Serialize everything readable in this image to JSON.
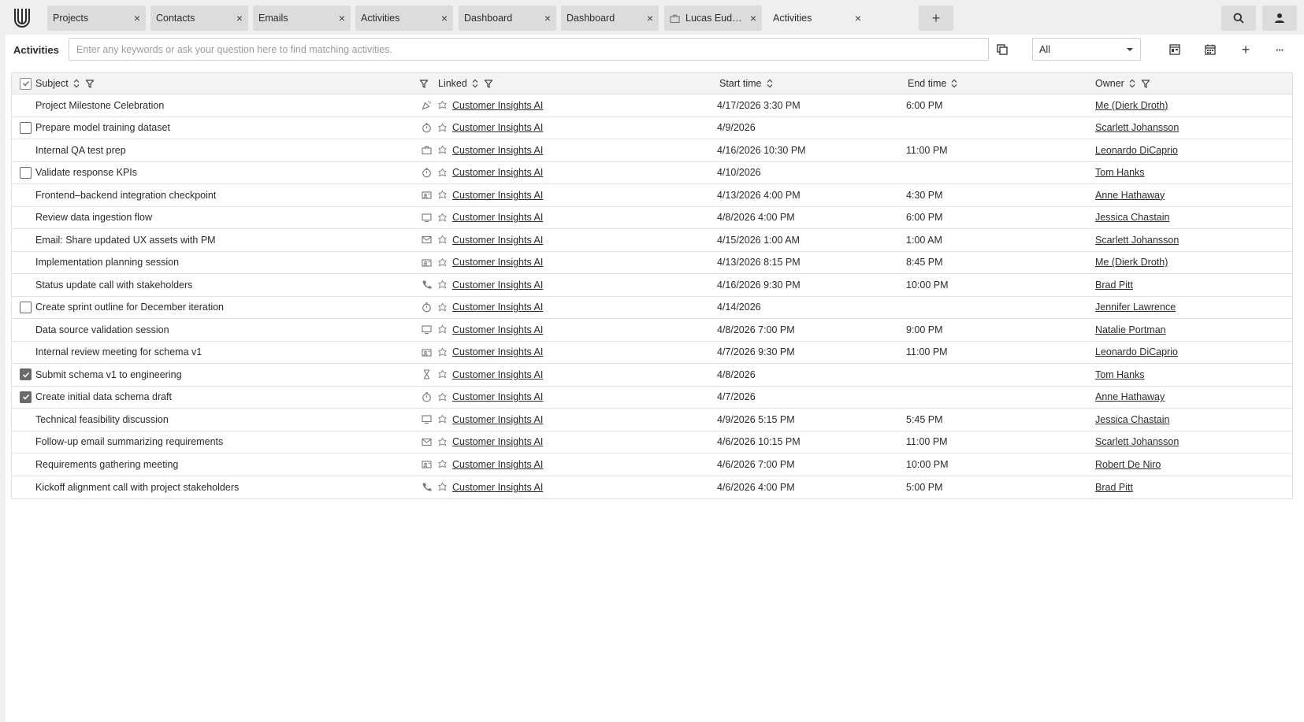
{
  "tabs": [
    {
      "label": "Projects",
      "close": "×"
    },
    {
      "label": "Contacts",
      "close": "×"
    },
    {
      "label": "Emails",
      "close": "×"
    },
    {
      "label": "Activities",
      "close": "×"
    },
    {
      "label": "Dashboard",
      "close": "×"
    },
    {
      "label": "Dashboard",
      "close": "×"
    },
    {
      "label": "Lucas Eudora...",
      "close": "×",
      "icon": "briefcase-icon"
    },
    {
      "label": "Activities",
      "close": "×",
      "active": true
    }
  ],
  "add_tab_label": "+",
  "toolbar": {
    "title": "Activities",
    "search_placeholder": "Enter any keywords or ask your question here to find matching activities.",
    "filter_value": "All",
    "add_label": "+",
    "more_label": "···"
  },
  "columns": {
    "subject": "Subject",
    "linked": "Linked",
    "start": "Start time",
    "end": "End time",
    "owner": "Owner"
  },
  "rows": [
    {
      "subject": "Project Milestone Celebration",
      "check": "none",
      "type_icon": "party-icon",
      "linked": "Customer Insights AI",
      "start": "4/17/2026 3:30 PM",
      "end": "6:00 PM",
      "owner": "Me (Dierk Droth)"
    },
    {
      "subject": "Prepare model training dataset",
      "check": "unchecked",
      "type_icon": "timer-icon",
      "linked": "Customer Insights AI",
      "start": "4/9/2026",
      "end": "",
      "owner": "Scarlett Johansson"
    },
    {
      "subject": "Internal QA test prep",
      "check": "none",
      "type_icon": "briefcase-icon",
      "linked": "Customer Insights AI",
      "start": "4/16/2026 10:30 PM",
      "end": "11:00 PM",
      "owner": "Leonardo DiCaprio"
    },
    {
      "subject": "Validate response KPIs",
      "check": "unchecked",
      "type_icon": "timer-icon",
      "linked": "Customer Insights AI",
      "start": "4/10/2026",
      "end": "",
      "owner": "Tom Hanks"
    },
    {
      "subject": "Frontend–backend integration checkpoint",
      "check": "none",
      "type_icon": "meeting-icon",
      "linked": "Customer Insights AI",
      "start": "4/13/2026 4:00 PM",
      "end": "4:30 PM",
      "owner": "Anne Hathaway"
    },
    {
      "subject": "Review data ingestion flow",
      "check": "none",
      "type_icon": "screen-icon",
      "linked": "Customer Insights AI",
      "start": "4/8/2026 4:00 PM",
      "end": "6:00 PM",
      "owner": "Jessica Chastain"
    },
    {
      "subject": "Email: Share updated UX assets with PM",
      "check": "none",
      "type_icon": "email-icon",
      "linked": "Customer Insights AI",
      "start": "4/15/2026 1:00 AM",
      "end": "1:00 AM",
      "owner": "Scarlett Johansson"
    },
    {
      "subject": "Implementation planning session",
      "check": "none",
      "type_icon": "meeting-icon",
      "linked": "Customer Insights AI",
      "start": "4/13/2026 8:15 PM",
      "end": "8:45 PM",
      "owner": "Me (Dierk Droth)"
    },
    {
      "subject": "Status update call with stakeholders",
      "check": "none",
      "type_icon": "phone-icon",
      "linked": "Customer Insights AI",
      "start": "4/16/2026 9:30 PM",
      "end": "10:00 PM",
      "owner": "Brad Pitt"
    },
    {
      "subject": "Create sprint outline for December iteration",
      "check": "unchecked",
      "type_icon": "timer-icon",
      "linked": "Customer Insights AI",
      "start": "4/14/2026",
      "end": "",
      "owner": "Jennifer Lawrence"
    },
    {
      "subject": "Data source validation session",
      "check": "none",
      "type_icon": "screen-icon",
      "linked": "Customer Insights AI",
      "start": "4/8/2026 7:00 PM",
      "end": "9:00 PM",
      "owner": "Natalie Portman"
    },
    {
      "subject": "Internal review meeting for schema v1",
      "check": "none",
      "type_icon": "meeting-icon",
      "linked": "Customer Insights AI",
      "start": "4/7/2026 9:30 PM",
      "end": "11:00 PM",
      "owner": "Leonardo DiCaprio"
    },
    {
      "subject": "Submit schema v1 to engineering",
      "check": "checked",
      "type_icon": "hourglass-icon",
      "linked": "Customer Insights AI",
      "start": "4/8/2026",
      "end": "",
      "owner": "Tom Hanks"
    },
    {
      "subject": "Create initial data schema draft",
      "check": "checked",
      "type_icon": "timer-icon",
      "linked": "Customer Insights AI",
      "start": "4/7/2026",
      "end": "",
      "owner": "Anne Hathaway"
    },
    {
      "subject": "Technical feasibility discussion",
      "check": "none",
      "type_icon": "screen-icon",
      "linked": "Customer Insights AI",
      "start": "4/9/2026 5:15 PM",
      "end": "5:45 PM",
      "owner": "Jessica Chastain"
    },
    {
      "subject": "Follow-up email summarizing requirements",
      "check": "none",
      "type_icon": "email-icon",
      "linked": "Customer Insights AI",
      "start": "4/6/2026 10:15 PM",
      "end": "11:00 PM",
      "owner": "Scarlett Johansson"
    },
    {
      "subject": "Requirements gathering meeting",
      "check": "none",
      "type_icon": "meeting-icon",
      "linked": "Customer Insights AI",
      "start": "4/6/2026 7:00 PM",
      "end": "10:00 PM",
      "owner": "Robert De Niro"
    },
    {
      "subject": "Kickoff alignment call with project stakeholders",
      "check": "none",
      "type_icon": "phone-icon",
      "linked": "Customer Insights AI",
      "start": "4/6/2026 4:00 PM",
      "end": "5:00 PM",
      "owner": "Brad Pitt"
    }
  ]
}
